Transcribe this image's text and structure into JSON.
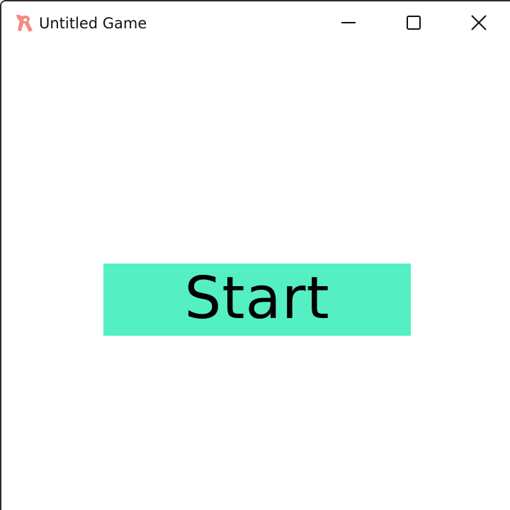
{
  "window": {
    "title": "Untitled Game",
    "icon": "ribbon-r-logo-icon",
    "controls": {
      "minimize_icon": "minimize-icon",
      "maximize_icon": "maximize-icon",
      "close_icon": "close-icon"
    }
  },
  "main": {
    "start_button": {
      "label": "Start",
      "color": "#55efc4"
    }
  },
  "colors": {
    "app_icon": "#f08c7d",
    "background": "#ffffff",
    "accent": "#55efc4"
  }
}
